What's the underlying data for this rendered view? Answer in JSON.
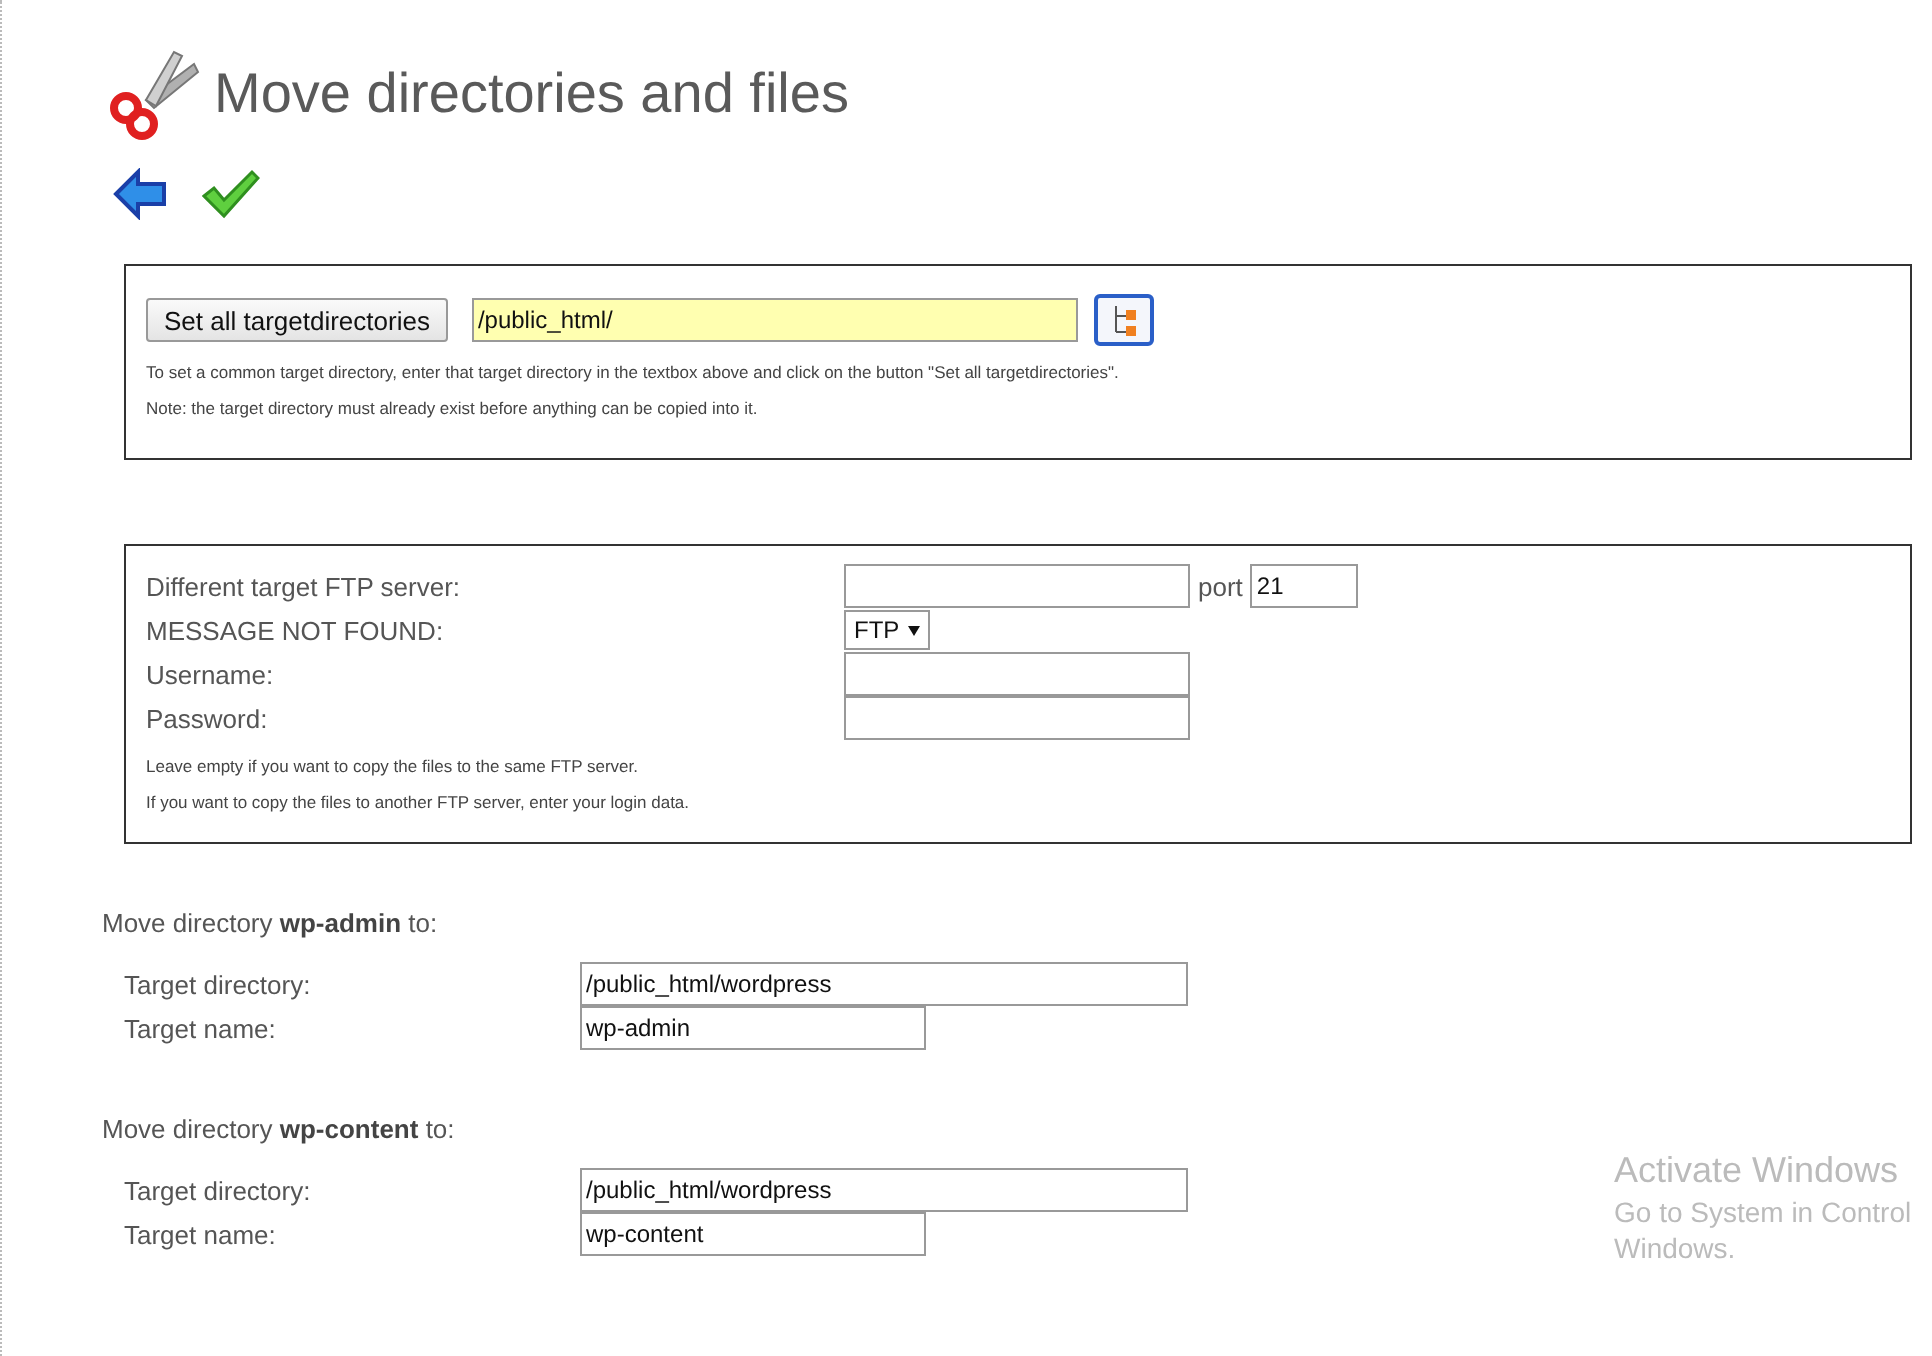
{
  "header": {
    "title": "Move directories and files"
  },
  "toolbar": {
    "buttons": [
      {
        "kind": "back"
      },
      {
        "kind": "confirm"
      }
    ]
  },
  "common_target": {
    "button": "Set all targetdirectories",
    "value": "/public_html/",
    "help": [
      "To set a common target directory, enter that target directory in the textbox above and click on the button \"Set all targetdirectories\".",
      "Note: the target directory must already exist before anything can be copied into it."
    ]
  },
  "ftp": {
    "fields": [
      {
        "kind": "text",
        "label": "Different target FTP server:",
        "port_label": "port",
        "port_value": "21"
      },
      {
        "kind": "select",
        "label": "MESSAGE NOT FOUND:",
        "value": "FTP"
      },
      {
        "kind": "text",
        "label": "Username:"
      },
      {
        "kind": "password",
        "label": "Password:"
      }
    ],
    "help": [
      "Leave empty if you want to copy the files to the same FTP server.",
      "If you want to copy the files to another FTP server, enter your login data."
    ]
  },
  "directories": [
    {
      "heading": "Move directory **wp-admin** to:",
      "dir_label": "Target directory:",
      "dir_value": "/public_html/wordpress",
      "name_label": "Target name:",
      "name_value": "wp-admin"
    },
    {
      "heading": "Move directory **wp-content** to:",
      "dir_label": "Target directory:",
      "dir_value": "/public_html/wordpress",
      "name_label": "Target name:",
      "name_value": "wp-content"
    }
  ],
  "activation_notice": {
    "title": "Activate Windows",
    "lines": [
      "Go to System in Control",
      "Windows."
    ]
  }
}
